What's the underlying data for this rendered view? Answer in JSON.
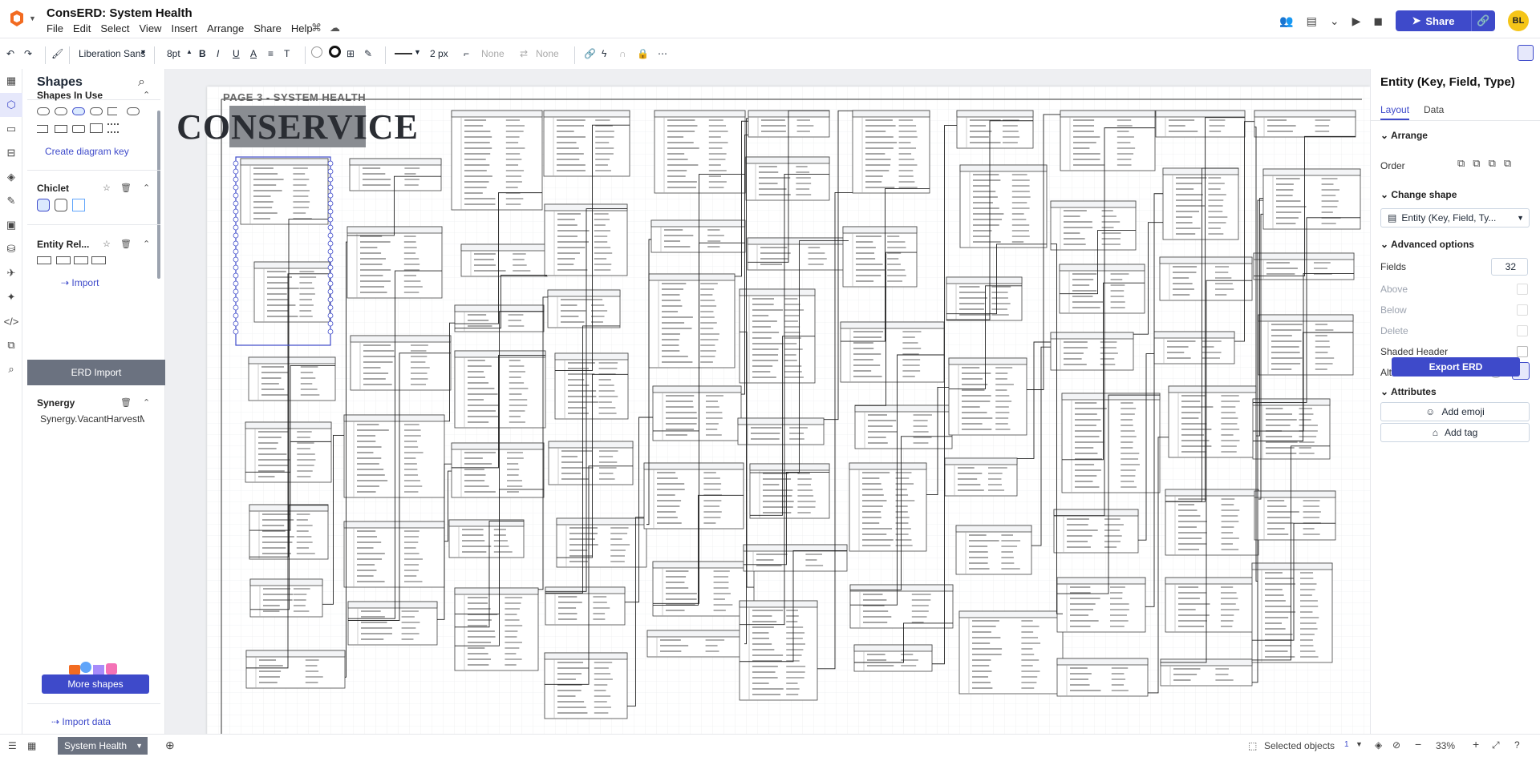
{
  "app": {
    "title": "ConsERD: System Health"
  },
  "menu": [
    "File",
    "Edit",
    "Select",
    "View",
    "Insert",
    "Arrange",
    "Share",
    "Help"
  ],
  "header": {
    "share_label": "Share",
    "avatar_initials": "BL"
  },
  "toolbar": {
    "font": "Liberation Sans",
    "font_size": "8pt",
    "line_width": "2 px",
    "start_arrow": "None",
    "end_arrow": "None"
  },
  "shapes_panel": {
    "title": "Shapes",
    "sections": {
      "in_use": "Shapes In Use",
      "create_key": "Create diagram key",
      "chiclet": "Chiclet",
      "entity": "Entity Rel...",
      "import": "Import",
      "erd_import": "ERD Import",
      "synergy": "Synergy",
      "synergy_item": "Synergy.VacantHarvestM"
    },
    "more_shapes": "More shapes",
    "import_data": "Import data"
  },
  "canvas": {
    "page_label": "PAGE 3 - SYSTEM HEALTH",
    "brand": "CONSERVICE"
  },
  "right_panel": {
    "title": "Entity (Key, Field, Type)",
    "tabs": [
      "Layout",
      "Data"
    ],
    "arrange": "Arrange",
    "order": "Order",
    "change_shape": "Change shape",
    "shape_value": "Entity (Key, Field, Ty...",
    "advanced": "Advanced options",
    "fields_label": "Fields",
    "fields_value": "32",
    "above": "Above",
    "below": "Below",
    "delete": "Delete",
    "shaded_header": "Shaded Header",
    "alternate_rows": "Alternate Rows",
    "export_erd": "Export ERD",
    "attributes": "Attributes",
    "add_emoji": "Add emoji",
    "add_tag": "Add tag"
  },
  "bottom": {
    "page_tab": "System Health",
    "selected_objects": "Selected objects",
    "selected_count": "1",
    "zoom": "33%"
  },
  "colors": {
    "accent": "#3e4aca",
    "panel_header": "#6b7280"
  }
}
